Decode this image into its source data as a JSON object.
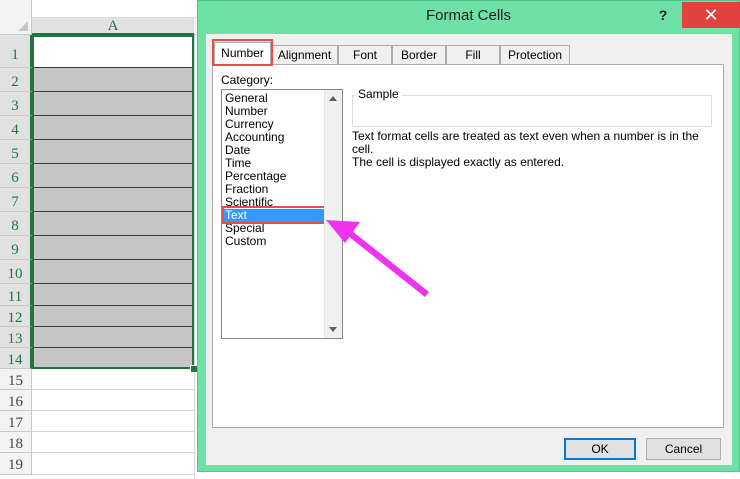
{
  "sheet": {
    "column_header": "A",
    "rows": [
      "1",
      "2",
      "3",
      "4",
      "5",
      "6",
      "7",
      "8",
      "9",
      "10",
      "11",
      "12",
      "13",
      "14",
      "15",
      "16",
      "17",
      "18",
      "19"
    ]
  },
  "dialog": {
    "title": "Format Cells",
    "help_label": "?",
    "close_label": "✕",
    "tabs": [
      "Number",
      "Alignment",
      "Font",
      "Border",
      "Fill",
      "Protection"
    ],
    "active_tab": "Number",
    "category_label": "Category:",
    "categories": [
      "General",
      "Number",
      "Currency",
      "Accounting",
      "Date",
      "Time",
      "Percentage",
      "Fraction",
      "Scientific",
      "Text",
      "Special",
      "Custom"
    ],
    "selected_category": "Text",
    "sample_label": "Sample",
    "description_line1": "Text format cells are treated as text even when a number is in the cell.",
    "description_line2": "The cell is displayed exactly as entered.",
    "ok_label": "OK",
    "cancel_label": "Cancel"
  },
  "colors": {
    "dialog_frame": "#6fe0a6",
    "close_button": "#e0433f",
    "highlight_outline": "#e84c4c",
    "selection": "#3399ff",
    "annotation_arrow": "#ee33ee",
    "excel_green": "#217346"
  }
}
